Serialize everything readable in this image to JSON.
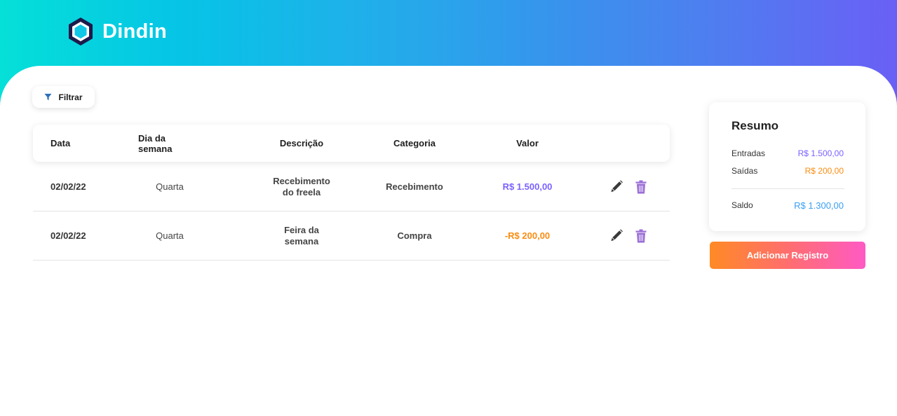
{
  "brand": {
    "name": "Dindin"
  },
  "filter": {
    "label": "Filtrar"
  },
  "table": {
    "headers": {
      "date": "Data",
      "weekday": "Dia da semana",
      "description": "Descrição",
      "category": "Categoria",
      "value": "Valor"
    },
    "rows": [
      {
        "date": "02/02/22",
        "weekday": "Quarta",
        "description_line1": "Recebimento",
        "description_line2": "do freela",
        "category": "Recebimento",
        "value": "R$ 1.500,00",
        "value_color": "#7b61ff"
      },
      {
        "date": "02/02/22",
        "weekday": "Quarta",
        "description_line1": "Feira da",
        "description_line2": "semana",
        "category": "Compra",
        "value": "-R$ 200,00",
        "value_color": "#fa8c10"
      }
    ],
    "row_actions": [
      "pencil-icon",
      "trash-icon"
    ]
  },
  "summary": {
    "title": "Resumo",
    "income_label": "Entradas",
    "income_value": "R$ 1.500,00",
    "income_color": "#7b61ff",
    "expense_label": "Saídas",
    "expense_value": "R$ 200,00",
    "expense_color": "#fa8c10",
    "balance_label": "Saldo",
    "balance_value": "R$ 1.300,00",
    "balance_color": "#3a9ff1"
  },
  "add_button": {
    "label": "Adicionar Registro"
  },
  "colors": {
    "header_gradient": [
      "#05e0d8",
      "#6a5ff5"
    ],
    "add_button_gradient": [
      "#ff8a25",
      "#ff5ac4"
    ],
    "trash_icon": "#9b6fd6"
  }
}
